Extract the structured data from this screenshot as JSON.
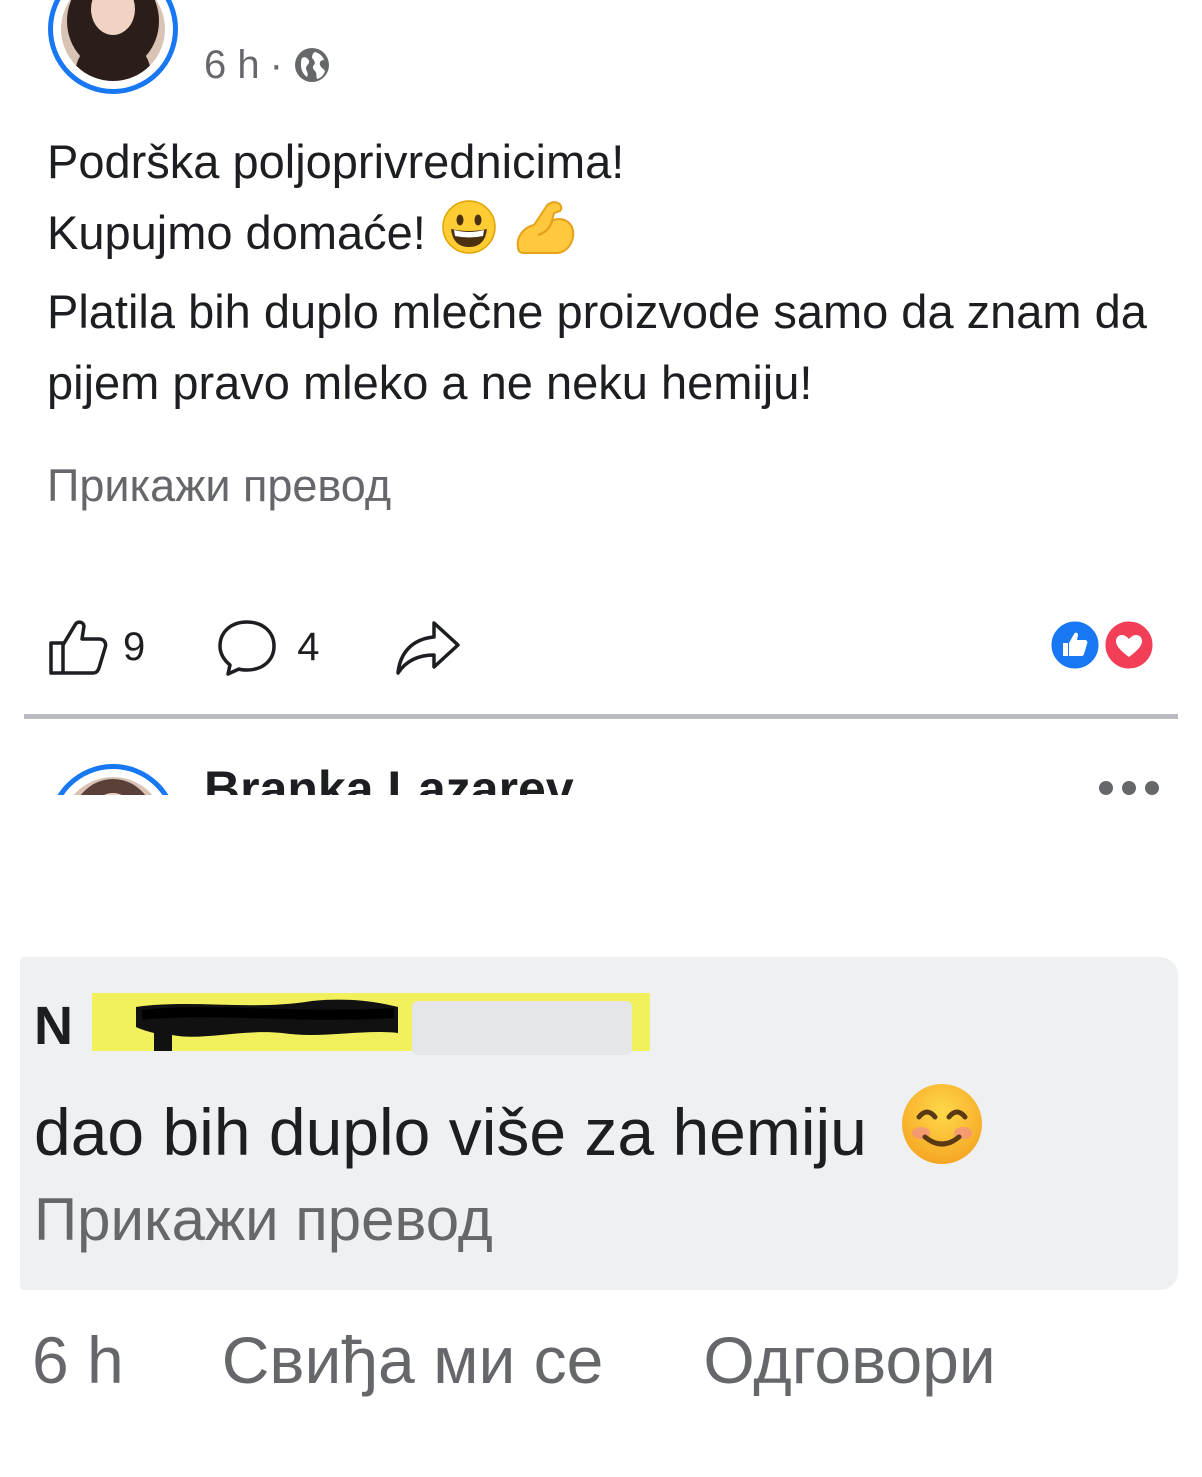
{
  "post": {
    "time": "6 h",
    "separator": "·",
    "audience_icon": "globe-icon",
    "text_line1": "Podrška poljoprivrednicima!",
    "text_line2": "Kupujmo domaće!",
    "text_line2_emojis": [
      "grinning-face-icon",
      "flexed-biceps-icon"
    ],
    "text_rest": "Platila bih duplo mlečne proizvode samo da znam da pijem pravo mleko a ne neku hemiju!",
    "see_translation": "Прикажи превод",
    "likes_count": "9",
    "comments_count": "4",
    "reactions": [
      "like-reaction-icon",
      "love-reaction-icon"
    ]
  },
  "next_post": {
    "author_partial": "Branka Lazarev"
  },
  "comment": {
    "author_visible": "N",
    "text": "dao bih duplo više za hemiju",
    "text_emoji": "smiling-face-icon",
    "see_translation": "Прикажи превод",
    "time": "6 h",
    "like_label": "Свиђа ми се",
    "reply_label": "Одговори"
  },
  "colors": {
    "accent": "#1877f2",
    "love": "#f33e58",
    "secondary_text": "#65676b",
    "comment_bg": "#eff0f2",
    "highlight": "#f3f05d"
  }
}
